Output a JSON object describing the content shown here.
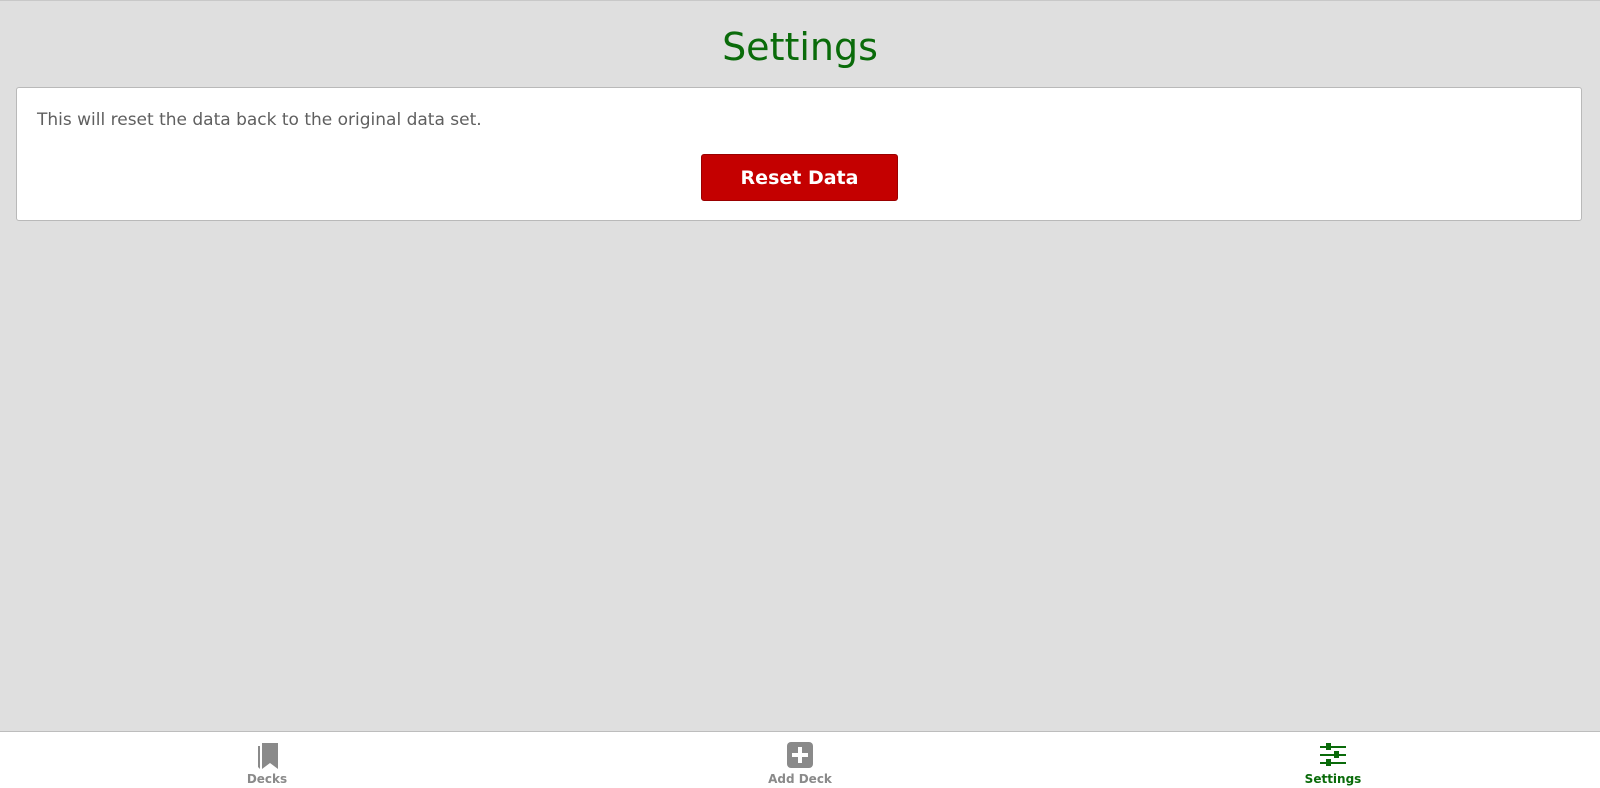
{
  "header": {
    "title": "Settings"
  },
  "reset_card": {
    "description": "This will reset the data back to the original data set.",
    "button_label": "Reset Data"
  },
  "tabbar": {
    "tabs": [
      {
        "label": "Decks",
        "icon": "bookmarks-icon",
        "active": false
      },
      {
        "label": "Add Deck",
        "icon": "plus-square-icon",
        "active": false
      },
      {
        "label": "Settings",
        "icon": "sliders-icon",
        "active": true
      }
    ]
  },
  "colors": {
    "accent": "#0a6b0a",
    "danger": "#c40000",
    "inactive": "#8a8a8a",
    "background": "#dfdfdf"
  }
}
